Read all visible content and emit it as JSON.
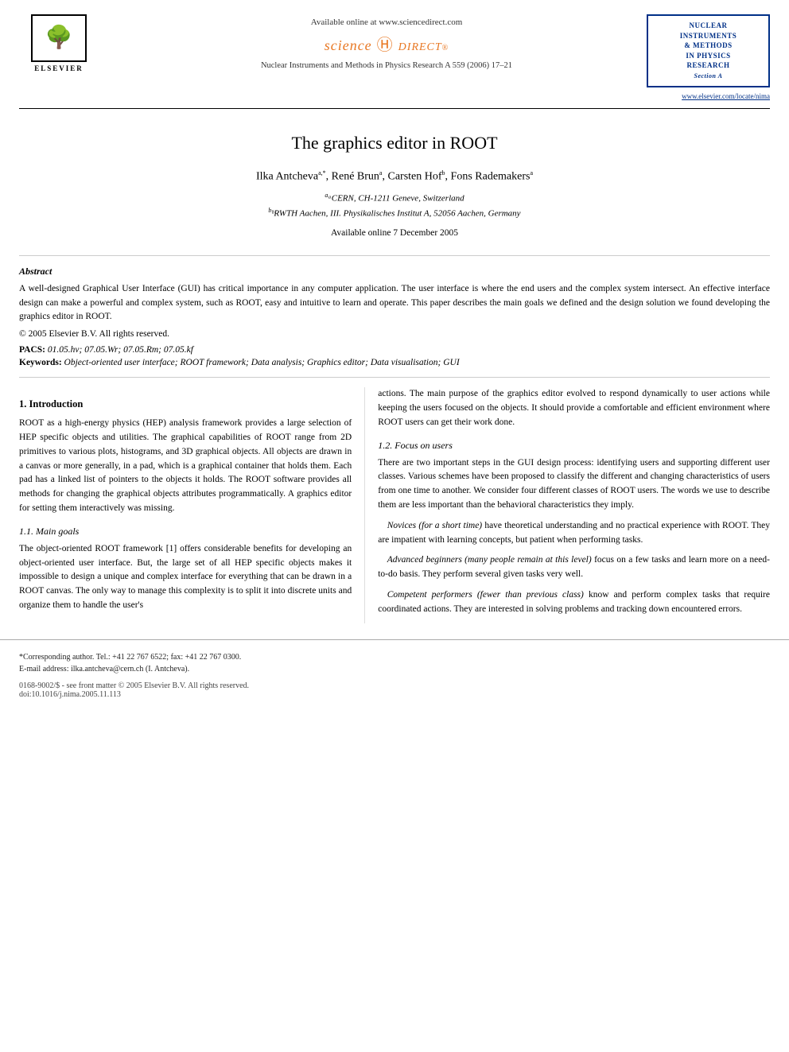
{
  "header": {
    "available_online": "Available online at www.sciencedirect.com",
    "journal_name": "Nuclear Instruments and Methods in Physics Research A 559 (2006) 17–21",
    "elsevier_label": "ELSEVIER",
    "journal_box": {
      "line1": "NUCLEAR",
      "line2": "INSTRUMENTS",
      "line3": "& METHODS",
      "line4": "IN PHYSICS",
      "line5": "RESEARCH",
      "line6": "Section A"
    },
    "elsevier_link": "www.elsevier.com/locate/nima"
  },
  "title_section": {
    "title": "The graphics editor in ROOT",
    "authors": "Ilka Antchevaᵃ,*, René Brunᵃ, Carsten Hofᵇ, Fons Rademakersᵃ",
    "affiliation_a": "ᵃCERN, CH-1211 Geneve, Switzerland",
    "affiliation_b": "ᵇRWTH Aachen, III. Physikalisches Institut A, 52056 Aachen, Germany",
    "available_date": "Available online 7 December 2005"
  },
  "abstract": {
    "label": "Abstract",
    "text": "A well-designed Graphical User Interface (GUI) has critical importance in any computer application. The user interface is where the end users and the complex system intersect. An effective interface design can make a powerful and complex system, such as ROOT, easy and intuitive to learn and operate. This paper describes the main goals we defined and the design solution we found developing the graphics editor in ROOT.",
    "copyright": "© 2005 Elsevier B.V. All rights reserved.",
    "pacs_label": "PACS:",
    "pacs": "01.05.hv; 07.05.Wr; 07.05.Rm; 07.05.kf",
    "keywords_label": "Keywords:",
    "keywords": "Object-oriented user interface; ROOT framework; Data analysis; Graphics editor; Data visualisation; GUI"
  },
  "body": {
    "section1": {
      "heading": "1. Introduction",
      "paragraph1": "ROOT as a high-energy physics (HEP) analysis framework provides a large selection of HEP specific objects and utilities. The graphical capabilities of ROOT range from 2D primitives to various plots, histograms, and 3D graphical objects. All objects are drawn in a canvas or more generally, in a pad, which is a graphical container that holds them. Each pad has a linked list of pointers to the objects it holds. The ROOT software provides all methods for changing the graphical objects attributes programmatically. A graphics editor for setting them interactively was missing."
    },
    "section1_1": {
      "heading": "1.1. Main goals",
      "paragraph1": "The object-oriented ROOT framework [1] offers considerable benefits for developing an object-oriented user interface. But, the large set of all HEP specific objects makes it impossible to design a unique and complex interface for everything that can be drawn in a ROOT canvas. The only way to manage this complexity is to split it into discrete units and organize them to handle the user's"
    },
    "right_col_intro": {
      "paragraph1": "actions. The main purpose of the graphics editor evolved to respond dynamically to user actions while keeping the users focused on the objects. It should provide a comfortable and efficient environment where ROOT users can get their work done."
    },
    "section1_2": {
      "heading": "1.2. Focus on users",
      "paragraph1": "There are two important steps in the GUI design process: identifying users and supporting different user classes. Various schemes have been proposed to classify the different and changing characteristics of users from one time to another. We consider four different classes of ROOT users. The words we use to describe them are less important than the behavioral characteristics they imply.",
      "paragraph2": "Novices (for a short time) have theoretical understanding and no practical experience with ROOT. They are impatient with learning concepts, but patient when performing tasks.",
      "paragraph3": "Advanced beginners (many people remain at this level) focus on a few tasks and learn more on a need-to-do basis. They perform several given tasks very well.",
      "paragraph4": "Competent performers (fewer than previous class) know and perform complex tasks that require coordinated actions. They are interested in solving problems and tracking down encountered errors."
    }
  },
  "footer": {
    "corresponding_author": "*Corresponding author. Tel.: +41 22 767 6522; fax: +41 22 767 0300.",
    "email": "E-mail address: ilka.antcheva@cern.ch (I. Antcheva).",
    "license": "0168-9002/$ - see front matter © 2005 Elsevier B.V. All rights reserved.",
    "doi": "doi:10.1016/j.nima.2005.11.113"
  }
}
